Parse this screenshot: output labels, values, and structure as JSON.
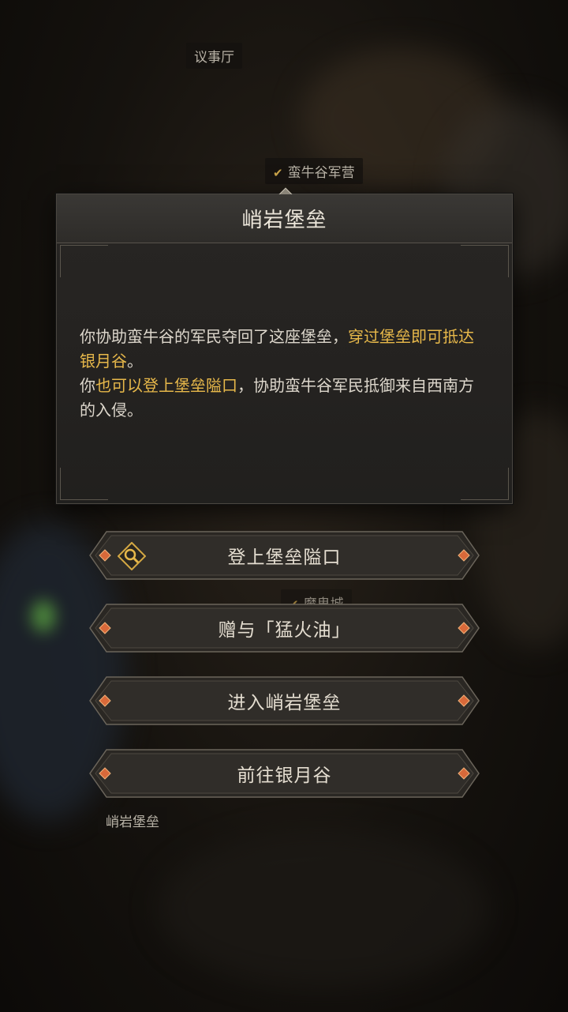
{
  "map": {
    "labels": [
      {
        "text": "议事厅",
        "checked": false
      },
      {
        "text": "蛮牛谷军营",
        "checked": true
      },
      {
        "text": "魔鬼城",
        "checked": true
      },
      {
        "text": "峭岩堡垒",
        "checked": false
      }
    ]
  },
  "dialog": {
    "title": "峭岩堡垒",
    "segments": [
      {
        "text": "你协助蛮牛谷的军民夺回了这座堡垒，",
        "highlight": false
      },
      {
        "text": "穿过堡垒即可抵达银月谷",
        "highlight": true
      },
      {
        "text": "。",
        "highlight": false
      },
      {
        "text": "你",
        "highlight": false
      },
      {
        "text": "也可以登上堡垒隘口",
        "highlight": true
      },
      {
        "text": "，协助蛮牛谷军民抵御来自西南方的入侵。",
        "highlight": false
      }
    ]
  },
  "actions": [
    {
      "label": "登上堡垒隘口",
      "icon": "magnifier-icon"
    },
    {
      "label": "赠与「猛火油」",
      "icon": null
    },
    {
      "label": "进入峭岩堡垒",
      "icon": null
    },
    {
      "label": "前往银月谷",
      "icon": null
    }
  ],
  "colors": {
    "highlight": "#e7b84a",
    "text": "#ddd7cc",
    "button_text": "#e4ddd0",
    "gem": "#d8693a"
  }
}
